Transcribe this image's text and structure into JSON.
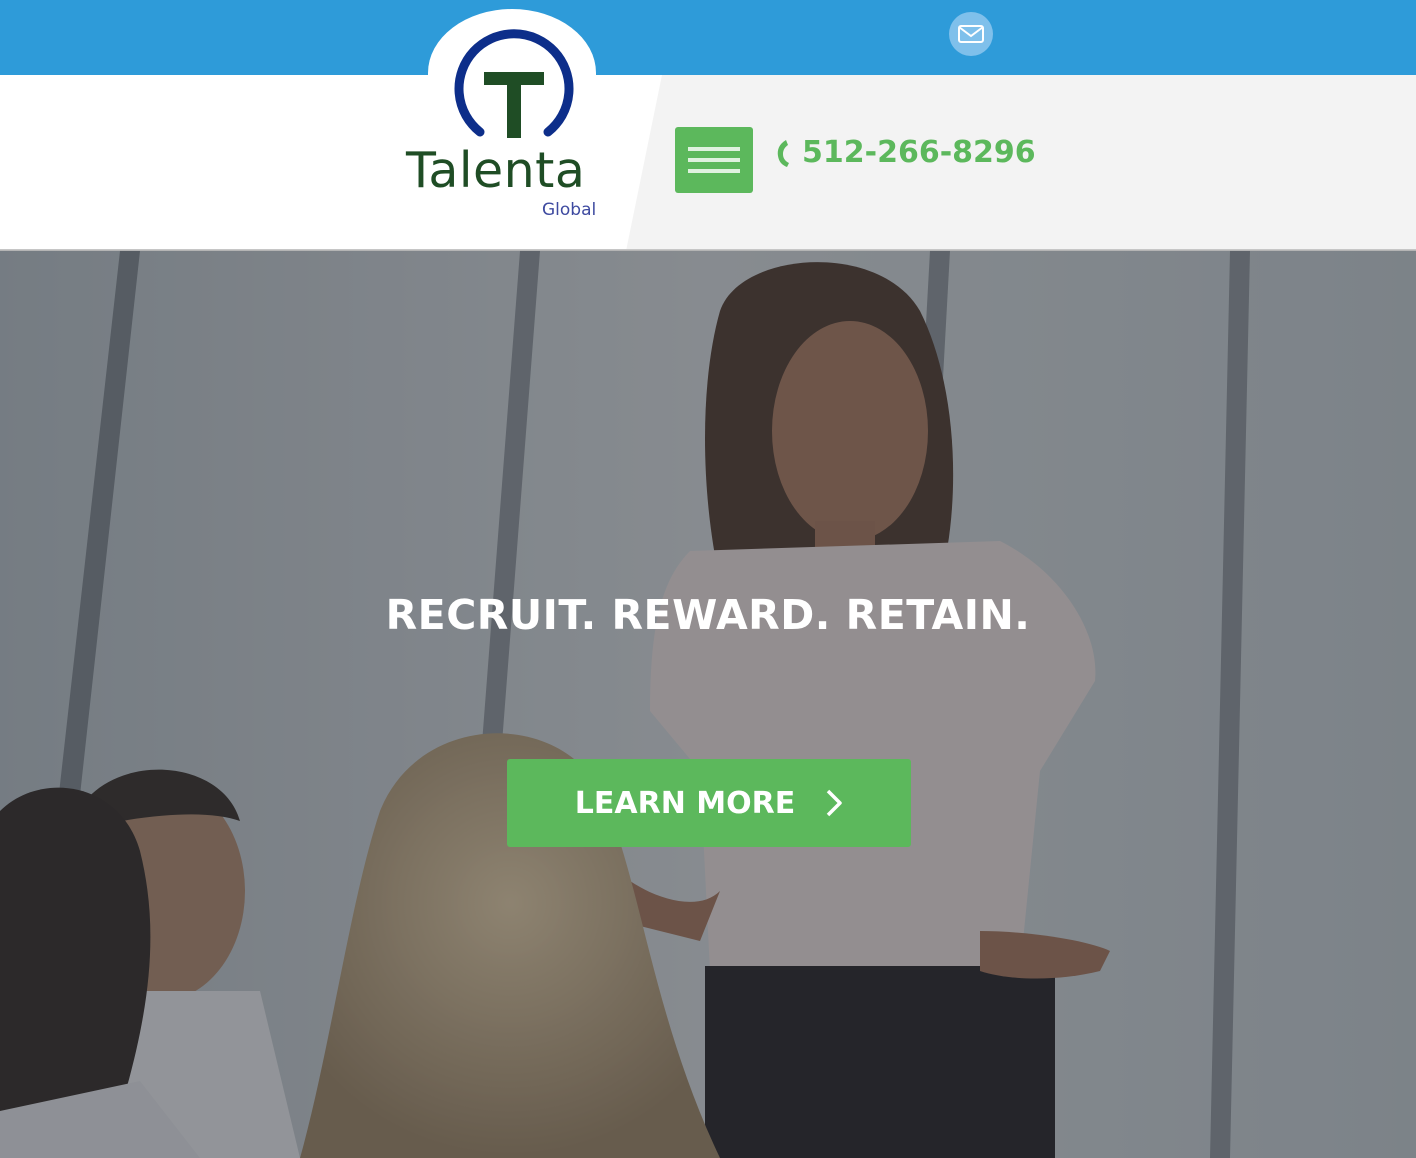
{
  "brand": {
    "name": "Talenta",
    "subname": "Global"
  },
  "header": {
    "phone": "512-266-8296",
    "icons": {
      "mail": "mail-icon",
      "menu": "hamburger-menu-icon",
      "phone": "phone-icon"
    }
  },
  "hero": {
    "headline": "RECRUIT. REWARD. RETAIN.",
    "cta_label": "LEARN MORE",
    "cta_icon": "chevron-right-icon"
  },
  "colors": {
    "topbar": "#2e9bd9",
    "accent_green": "#5cb85c",
    "logo_green": "#1f4d25",
    "logo_blue": "#0d2e8a"
  }
}
